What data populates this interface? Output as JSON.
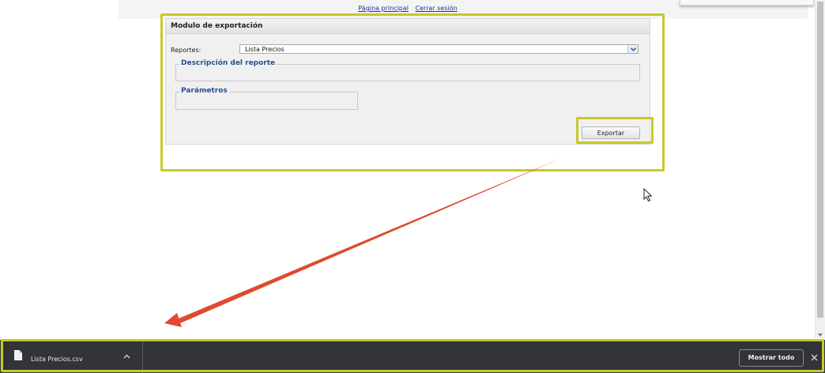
{
  "header": {
    "links": [
      {
        "label": "Página principal"
      },
      {
        "label": "Cerrar sesión"
      }
    ]
  },
  "panel": {
    "title": "Modulo de exportación",
    "reports_label": "Reportes:",
    "reports_value": "Lista Precios",
    "description_legend": "Descripción del reporte",
    "parameters_legend": "Parámetros",
    "export_label": "Exportar"
  },
  "download_bar": {
    "file_name": "Lista Precios.csv",
    "show_all_label": "Mostrar todo"
  },
  "colors": {
    "highlight": "#c7c92a",
    "arrow": "#e04a2f",
    "link": "#1a2fb3",
    "legend": "#2a4f8f",
    "download_bar_bg": "#333437"
  },
  "icons": [
    "chevron-down-icon",
    "cursor-icon",
    "file-icon",
    "caret-up-icon",
    "close-icon"
  ]
}
